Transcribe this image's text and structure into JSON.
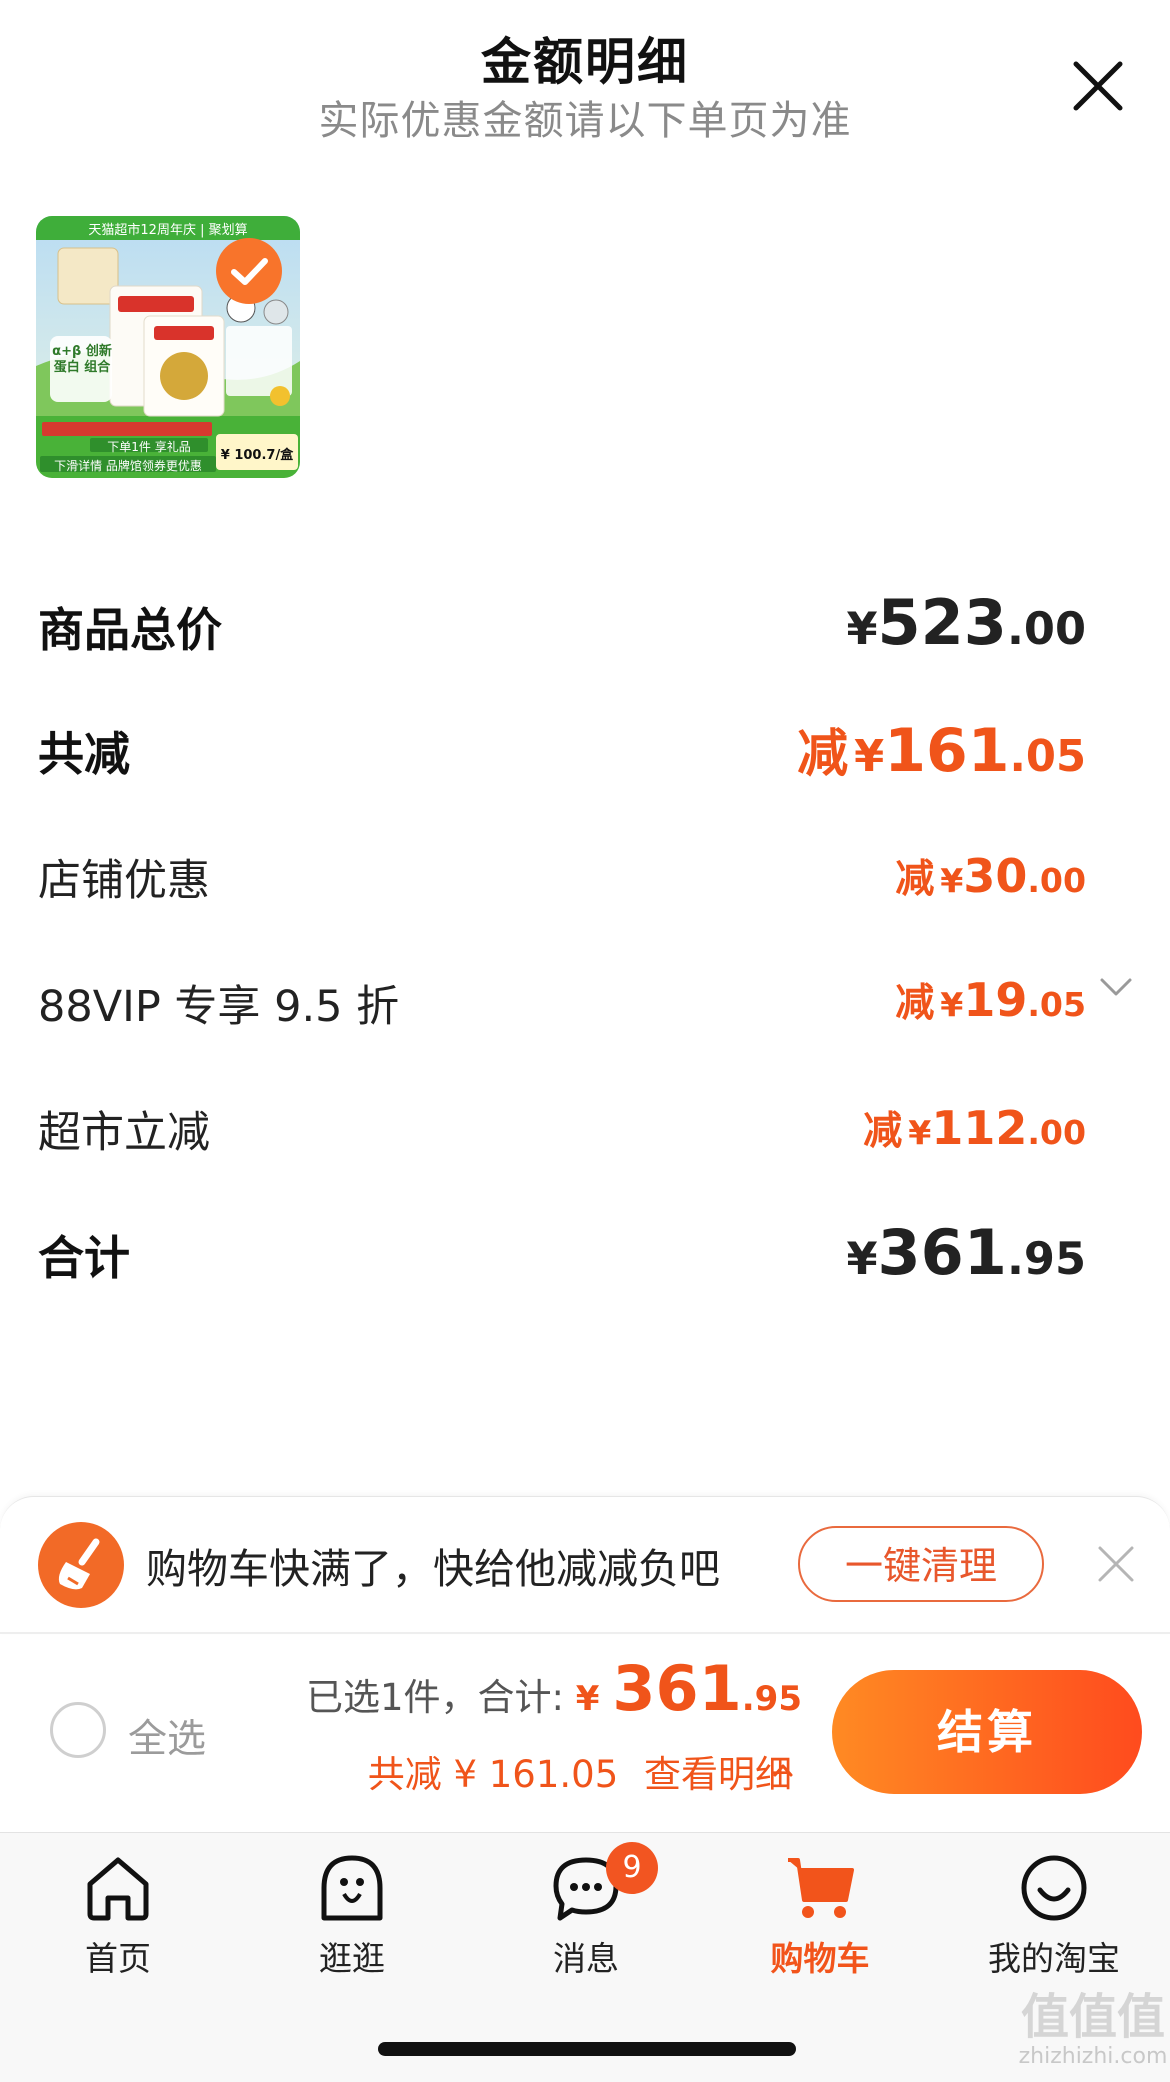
{
  "header": {
    "title": "金额明细",
    "subtitle": "实际优惠金额请以下单页为准"
  },
  "product": {
    "banner_text": "天猫超市12周年庆 | 聚划算",
    "badge_text": "α+β 创新蛋白 组合",
    "promo_text": "下单1件 享礼品",
    "footer_text": "下滑详情 品牌馆领券更优惠",
    "price_text": "¥ 100.7/盒",
    "selected": true
  },
  "summary": {
    "total_price": {
      "label": "商品总价",
      "sym": "¥",
      "int": "523",
      "dec": ".00"
    },
    "total_discount": {
      "label": "共减",
      "pre": "减",
      "sym": "¥",
      "int": "161",
      "dec": ".05"
    },
    "store_discount": {
      "label": "店铺优惠",
      "pre": "减",
      "sym": "¥",
      "int": "30",
      "dec": ".00"
    },
    "vip_discount": {
      "label": "88VIP 专享 9.5 折",
      "pre": "减",
      "sym": "¥",
      "int": "19",
      "dec": ".05"
    },
    "market_discount": {
      "label": "超市立减",
      "pre": "减",
      "sym": "¥",
      "int": "112",
      "dec": ".00"
    },
    "grand_total": {
      "label": "合计",
      "sym": "¥",
      "int": "361",
      "dec": ".95"
    }
  },
  "banner": {
    "text": "购物车快满了，快给他减减负吧",
    "button": "一键清理"
  },
  "checkout": {
    "select_all": "全选",
    "selected_text": "已选1件，合计:",
    "sym": "¥",
    "total_int": "361",
    "total_dec": ".95",
    "discount_text": "共减 ¥ 161.05",
    "detail_text": "查看明细",
    "button": "结算"
  },
  "tabs": [
    {
      "label": "首页",
      "icon": "home-icon"
    },
    {
      "label": "逛逛",
      "icon": "browse-icon"
    },
    {
      "label": "消息",
      "icon": "message-icon",
      "badge": "9"
    },
    {
      "label": "购物车",
      "icon": "cart-icon",
      "active": true
    },
    {
      "label": "我的淘宝",
      "icon": "profile-icon"
    }
  ],
  "colors": {
    "accent": "#f0541a",
    "checkout_gradient_start": "#ff8a23",
    "checkout_gradient_end": "#ff4b1e",
    "muted": "#8a8a8a"
  },
  "watermark": {
    "mark": "值值值",
    "text": "zhizhizhi.com"
  }
}
